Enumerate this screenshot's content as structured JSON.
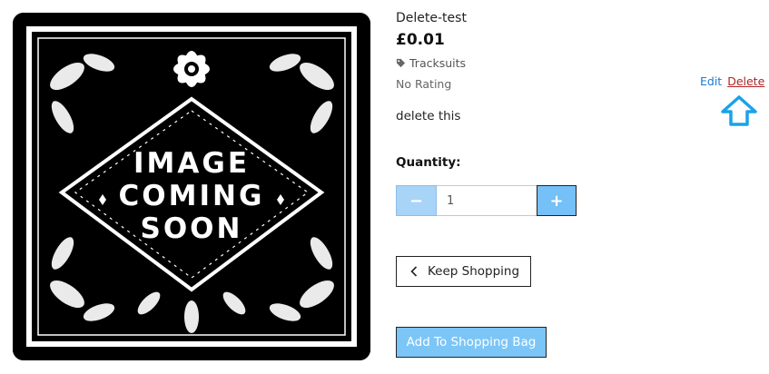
{
  "product": {
    "image_alt": "IMAGE COMING SOON",
    "image_lines": [
      "IMAGE",
      "COMING",
      "SOON"
    ],
    "name": "Delete-test",
    "price": "£0.01",
    "category": "Tracksuits",
    "category_icon": "tag-icon",
    "rating": "No Rating",
    "description": "delete this"
  },
  "admin": {
    "edit_label": "Edit",
    "delete_label": "Delete",
    "annotation_icon": "up-arrow-icon"
  },
  "quantity": {
    "label": "Quantity:",
    "value": "1",
    "minus_symbol": "−",
    "plus_symbol": "+"
  },
  "actions": {
    "keep_shopping_label": "Keep Shopping",
    "add_to_bag_label": "Add To Shopping Bag"
  },
  "colors": {
    "accent": "#74c0f7",
    "link": "#1a7ad6",
    "delete": "#b22222",
    "annotation": "#1aa3e8"
  }
}
